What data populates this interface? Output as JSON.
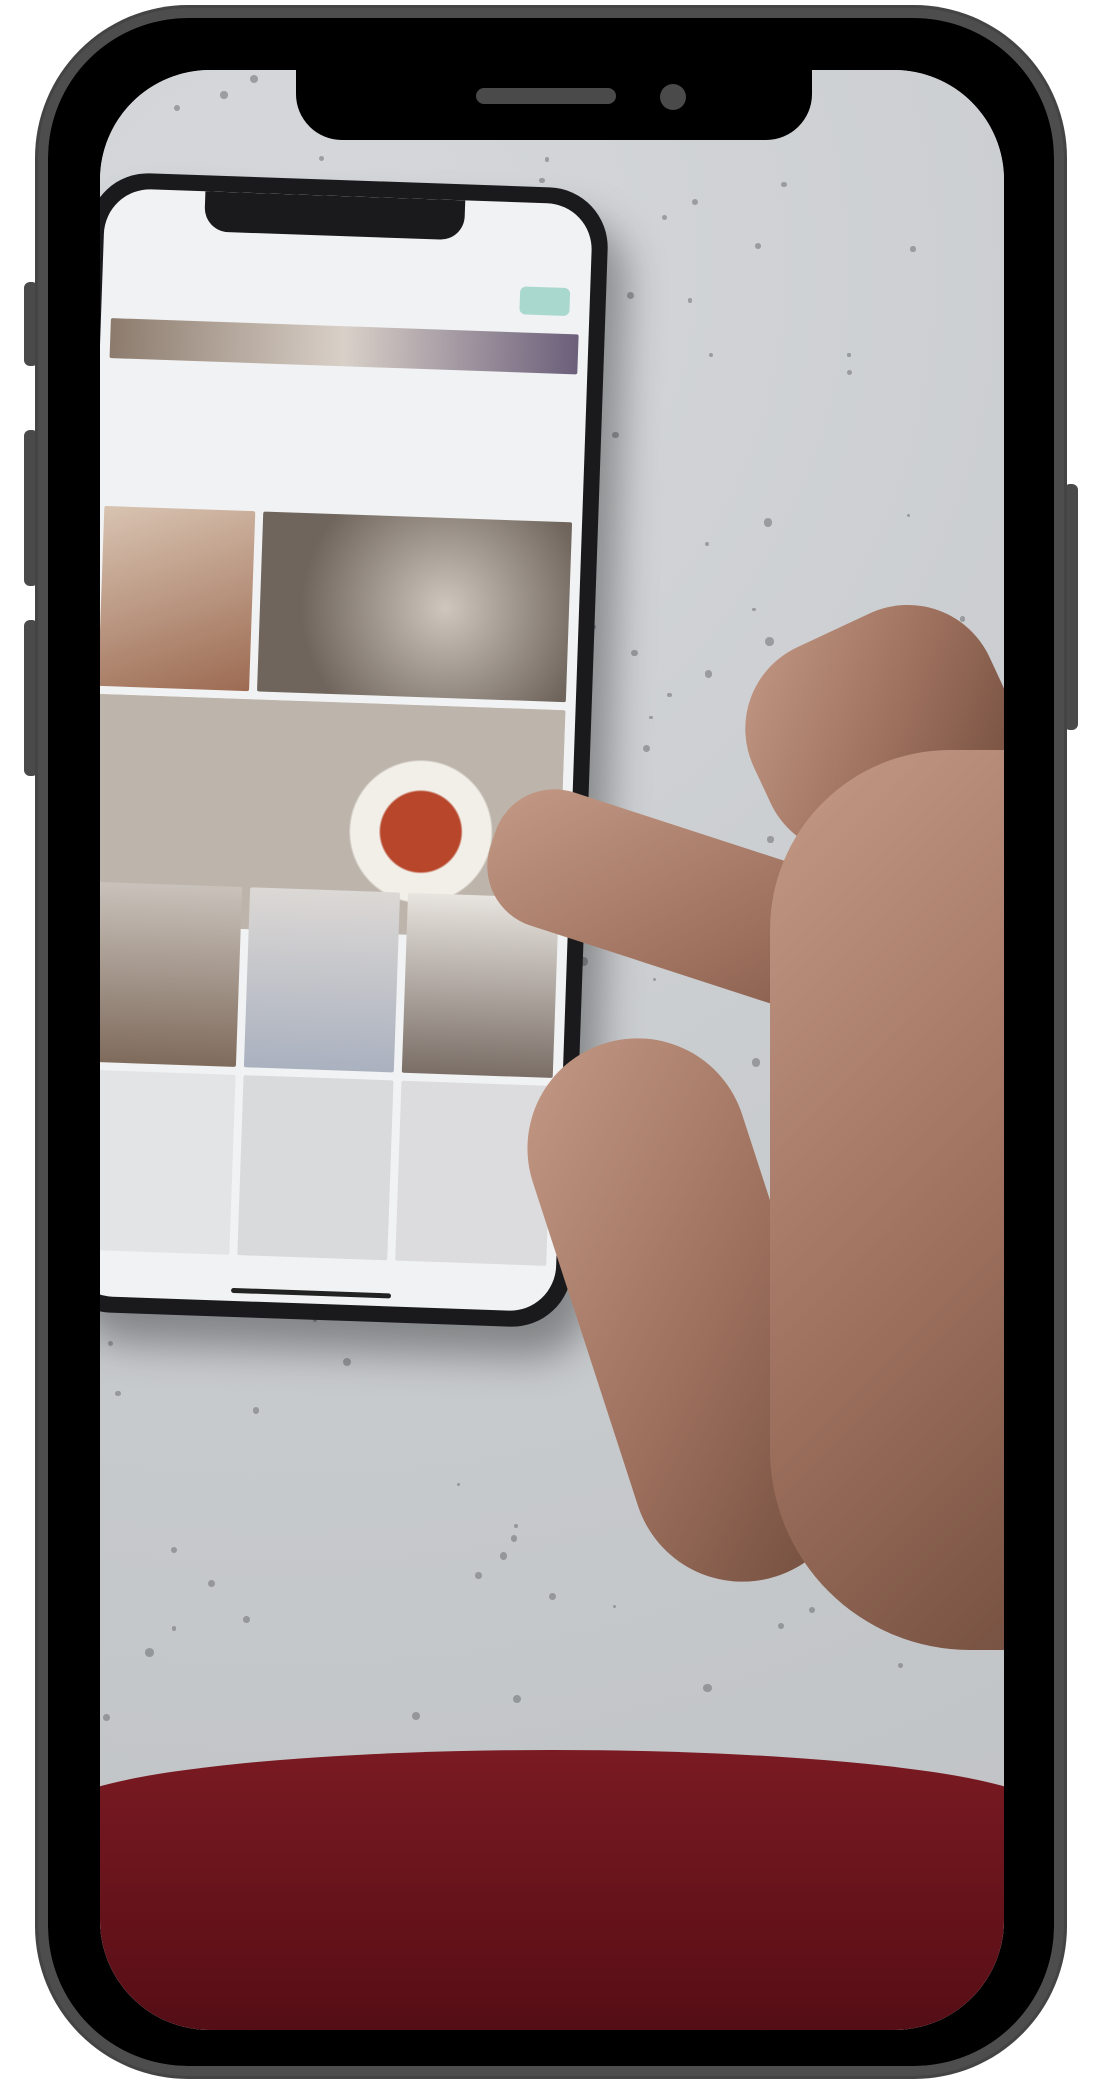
{
  "frame": {
    "type": "smartphone mockup",
    "bezel_color": "#000000",
    "rim_color": "#4d4d4d"
  },
  "photo": {
    "table_color": "#c9ccd0",
    "cloth_color": "#6b121b",
    "skin_color": "#b48470"
  },
  "inner_phone": {
    "accent_color": "#a9d8cf",
    "grid_tiles": 10
  }
}
